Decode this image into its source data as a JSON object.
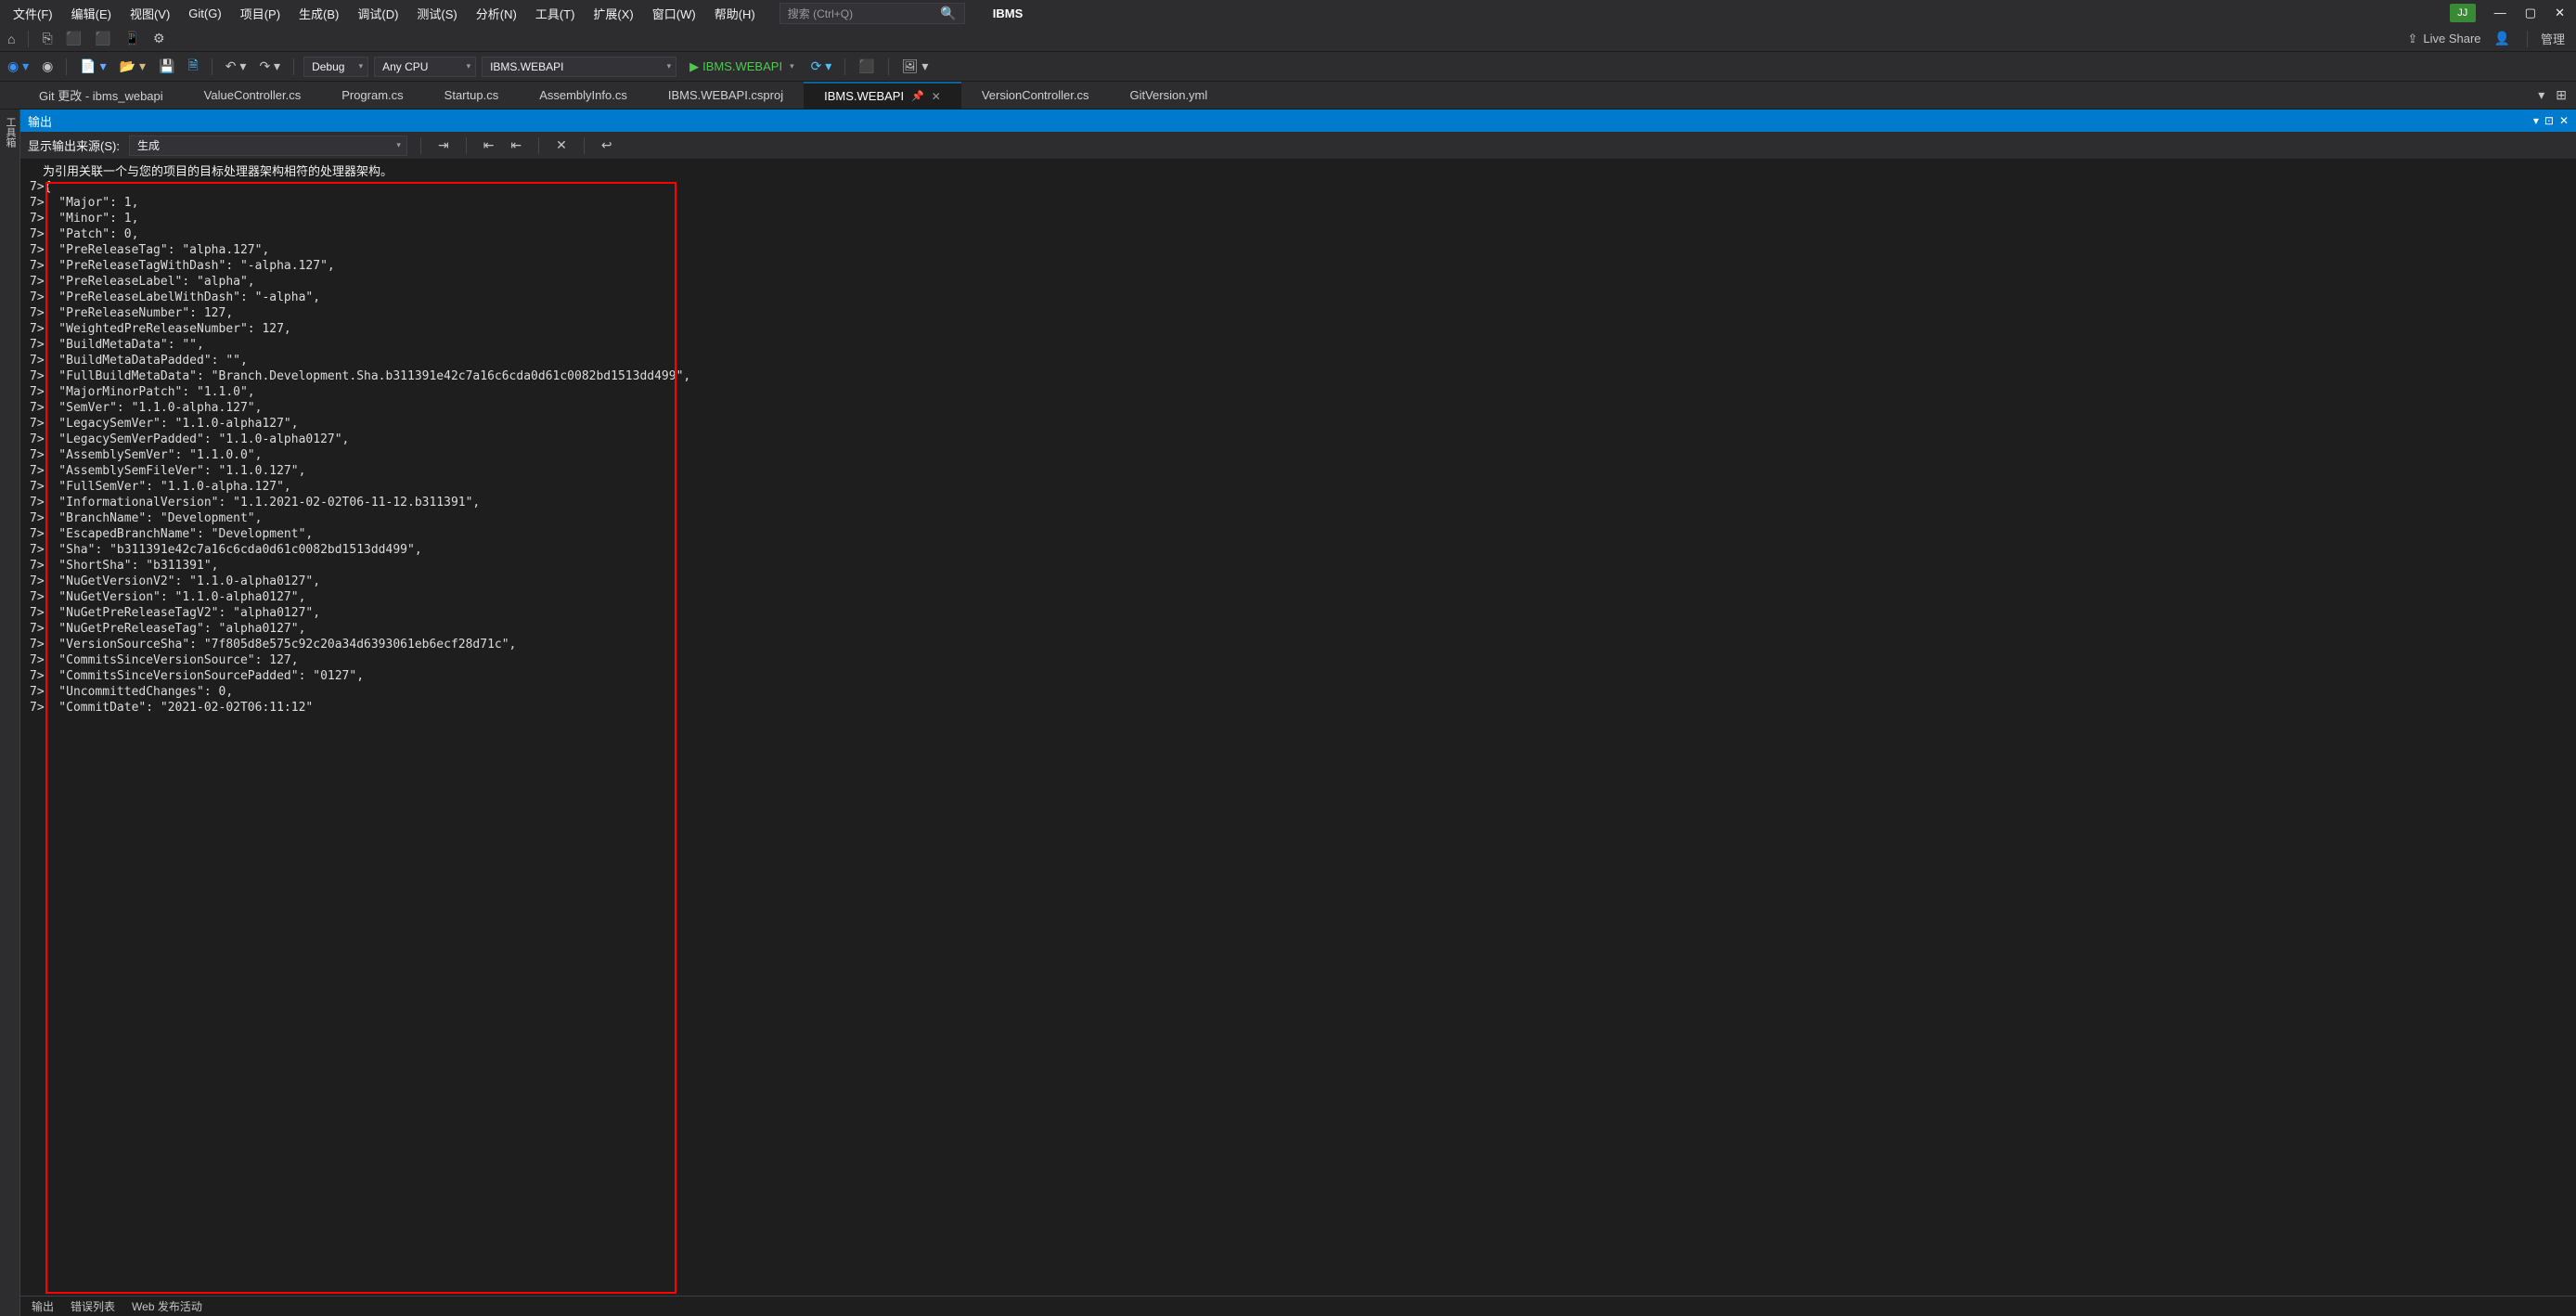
{
  "menu": {
    "file": "文件(F)",
    "edit": "编辑(E)",
    "view": "视图(V)",
    "git": "Git(G)",
    "project": "项目(P)",
    "build": "生成(B)",
    "debug": "调试(D)",
    "test": "测试(S)",
    "analyze": "分析(N)",
    "tools": "工具(T)",
    "extensions": "扩展(X)",
    "window": "窗口(W)",
    "help": "帮助(H)"
  },
  "search_placeholder": "搜索 (Ctrl+Q)",
  "solution_name": "IBMS",
  "user_badge": "JJ",
  "live_share": "Live Share",
  "right_group_label": "管理",
  "toolbar": {
    "config": "Debug",
    "platform": "Any CPU",
    "startup": "IBMS.WEBAPI",
    "run_target": "IBMS.WEBAPI"
  },
  "tabs": [
    {
      "label": "Git 更改 - ibms_webapi",
      "active": false
    },
    {
      "label": "ValueController.cs",
      "active": false
    },
    {
      "label": "Program.cs",
      "active": false
    },
    {
      "label": "Startup.cs",
      "active": false
    },
    {
      "label": "AssemblyInfo.cs",
      "active": false
    },
    {
      "label": "IBMS.WEBAPI.csproj",
      "active": false
    },
    {
      "label": "IBMS.WEBAPI",
      "active": true
    },
    {
      "label": "VersionController.cs",
      "active": false
    },
    {
      "label": "GitVersion.yml",
      "active": false
    }
  ],
  "output_panel": {
    "title": "输出",
    "source_label": "显示输出来源(S):",
    "source_value": "生成",
    "warning_msg": "为引用关联一个与您的项目的目标处理器架构相符的处理器架构。",
    "lines": [
      "7>{",
      "7>  \"Major\": 1,",
      "7>  \"Minor\": 1,",
      "7>  \"Patch\": 0,",
      "7>  \"PreReleaseTag\": \"alpha.127\",",
      "7>  \"PreReleaseTagWithDash\": \"-alpha.127\",",
      "7>  \"PreReleaseLabel\": \"alpha\",",
      "7>  \"PreReleaseLabelWithDash\": \"-alpha\",",
      "7>  \"PreReleaseNumber\": 127,",
      "7>  \"WeightedPreReleaseNumber\": 127,",
      "7>  \"BuildMetaData\": \"\",",
      "7>  \"BuildMetaDataPadded\": \"\",",
      "7>  \"FullBuildMetaData\": \"Branch.Development.Sha.b311391e42c7a16c6cda0d61c0082bd1513dd499\",",
      "7>  \"MajorMinorPatch\": \"1.1.0\",",
      "7>  \"SemVer\": \"1.1.0-alpha.127\",",
      "7>  \"LegacySemVer\": \"1.1.0-alpha127\",",
      "7>  \"LegacySemVerPadded\": \"1.1.0-alpha0127\",",
      "7>  \"AssemblySemVer\": \"1.1.0.0\",",
      "7>  \"AssemblySemFileVer\": \"1.1.0.127\",",
      "7>  \"FullSemVer\": \"1.1.0-alpha.127\",",
      "7>  \"InformationalVersion\": \"1.1.2021-02-02T06-11-12.b311391\",",
      "7>  \"BranchName\": \"Development\",",
      "7>  \"EscapedBranchName\": \"Development\",",
      "7>  \"Sha\": \"b311391e42c7a16c6cda0d61c0082bd1513dd499\",",
      "7>  \"ShortSha\": \"b311391\",",
      "7>  \"NuGetVersionV2\": \"1.1.0-alpha0127\",",
      "7>  \"NuGetVersion\": \"1.1.0-alpha0127\",",
      "7>  \"NuGetPreReleaseTagV2\": \"alpha0127\",",
      "7>  \"NuGetPreReleaseTag\": \"alpha0127\",",
      "7>  \"VersionSourceSha\": \"7f805d8e575c92c20a34d6393061eb6ecf28d71c\",",
      "7>  \"CommitsSinceVersionSource\": 127,",
      "7>  \"CommitsSinceVersionSourcePadded\": \"0127\",",
      "7>  \"UncommittedChanges\": 0,",
      "7>  \"CommitDate\": \"2021-02-02T06:11:12\""
    ]
  },
  "sidebar_tab": "工具箱",
  "status": {
    "output": "输出",
    "errors": "错误列表",
    "publish": "Web 发布活动"
  }
}
